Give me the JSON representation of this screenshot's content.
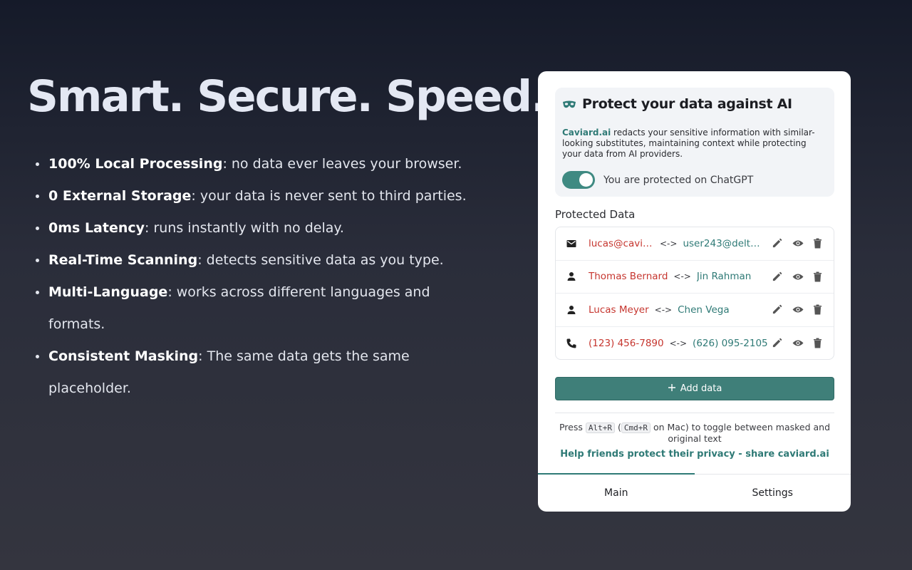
{
  "hero": {
    "title": "Smart. Secure. Speed.",
    "features": [
      {
        "bold": "100% Local Processing",
        "text": ": no data ever leaves your browser."
      },
      {
        "bold": "0 External Storage",
        "text": ": your data is never sent to third parties."
      },
      {
        "bold": "0ms Latency",
        "text": ": runs instantly with no delay."
      },
      {
        "bold": "Real-Time Scanning",
        "text": ": detects sensitive data as you type."
      },
      {
        "bold": "Multi-Language",
        "text": ": works across different languages and formats."
      },
      {
        "bold": "Consistent Masking",
        "text": ": The same data gets the same placeholder."
      }
    ]
  },
  "panel": {
    "title": "Protect your data against AI",
    "brand": "Caviard.ai",
    "description": " redacts your sensitive information with similar-looking substitutes, maintaining context while protecting your data from AI providers.",
    "toggle": {
      "on": true,
      "label": "You are protected on ChatGPT"
    },
    "protected_label": "Protected Data",
    "items": [
      {
        "icon": "email-icon",
        "original": "lucas@caviard.ai",
        "original_display": "lucas@cavia...",
        "separator": "<->",
        "masked": "user243@delta...",
        "masked_display": "user243@delta..."
      },
      {
        "icon": "person-icon",
        "original": "Thomas Bernard",
        "original_display": "Thomas Bernard",
        "separator": "<->",
        "masked": "Jin Rahman",
        "masked_display": "Jin Rahman"
      },
      {
        "icon": "person-icon",
        "original": "Lucas Meyer",
        "original_display": "Lucas Meyer",
        "separator": "<->",
        "masked": "Chen Vega",
        "masked_display": "Chen Vega"
      },
      {
        "icon": "phone-icon",
        "original": "(123) 456-7890",
        "original_display": "(123) 456-7890",
        "separator": "<->",
        "masked": "(626) 095-2105",
        "masked_display": "(626) 095-2105"
      }
    ],
    "add_label": "Add data",
    "hint": {
      "press": "Press",
      "key1": "Alt+R",
      "paren_open": "(",
      "key2": "Cmd+R",
      "rest": " on Mac) to toggle between masked and original text"
    },
    "share": "Help friends protect their privacy - share caviard.ai",
    "tabs": [
      {
        "label": "Main",
        "active": true
      },
      {
        "label": "Settings",
        "active": false
      }
    ],
    "colors": {
      "accent": "#2f7a76",
      "original": "#c6362f",
      "button": "#3f7f79"
    }
  }
}
